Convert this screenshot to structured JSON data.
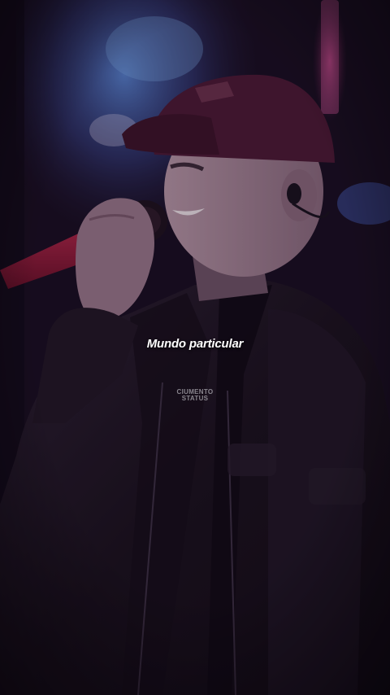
{
  "caption": {
    "text": "Mundo particular"
  },
  "watermark": {
    "line1": "CIUMENTO",
    "line2": "STATUS"
  },
  "colors": {
    "stage_light_blue": "#3f78c8",
    "stage_light_pink": "#d0408a",
    "cap": "#5a1a34",
    "jacket": "#1a1420",
    "microphone": "#9a1d3a"
  }
}
